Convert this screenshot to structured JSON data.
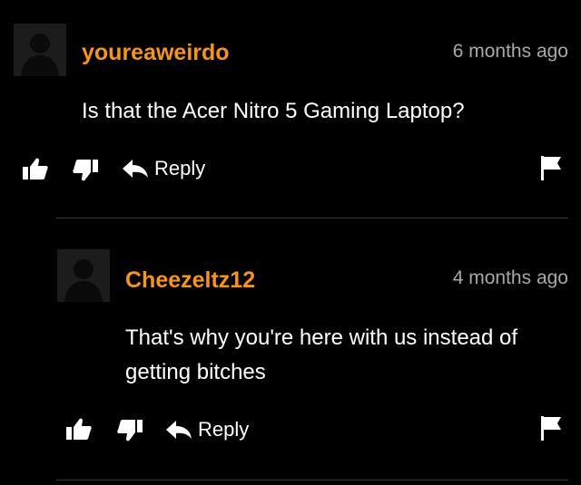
{
  "comments": [
    {
      "username": "youreaweirdo",
      "time": "6 months ago",
      "text": "Is that the Acer Nitro 5 Gaming Laptop?",
      "reply_label": "Reply"
    },
    {
      "username": "Cheezeltz12",
      "time": "4 months ago",
      "text": "That's why you're here with us instead of getting bitches",
      "reply_label": "Reply"
    }
  ],
  "colors": {
    "username": "#f7941d",
    "background": "#000000",
    "timestamp": "#a8a8a8"
  }
}
